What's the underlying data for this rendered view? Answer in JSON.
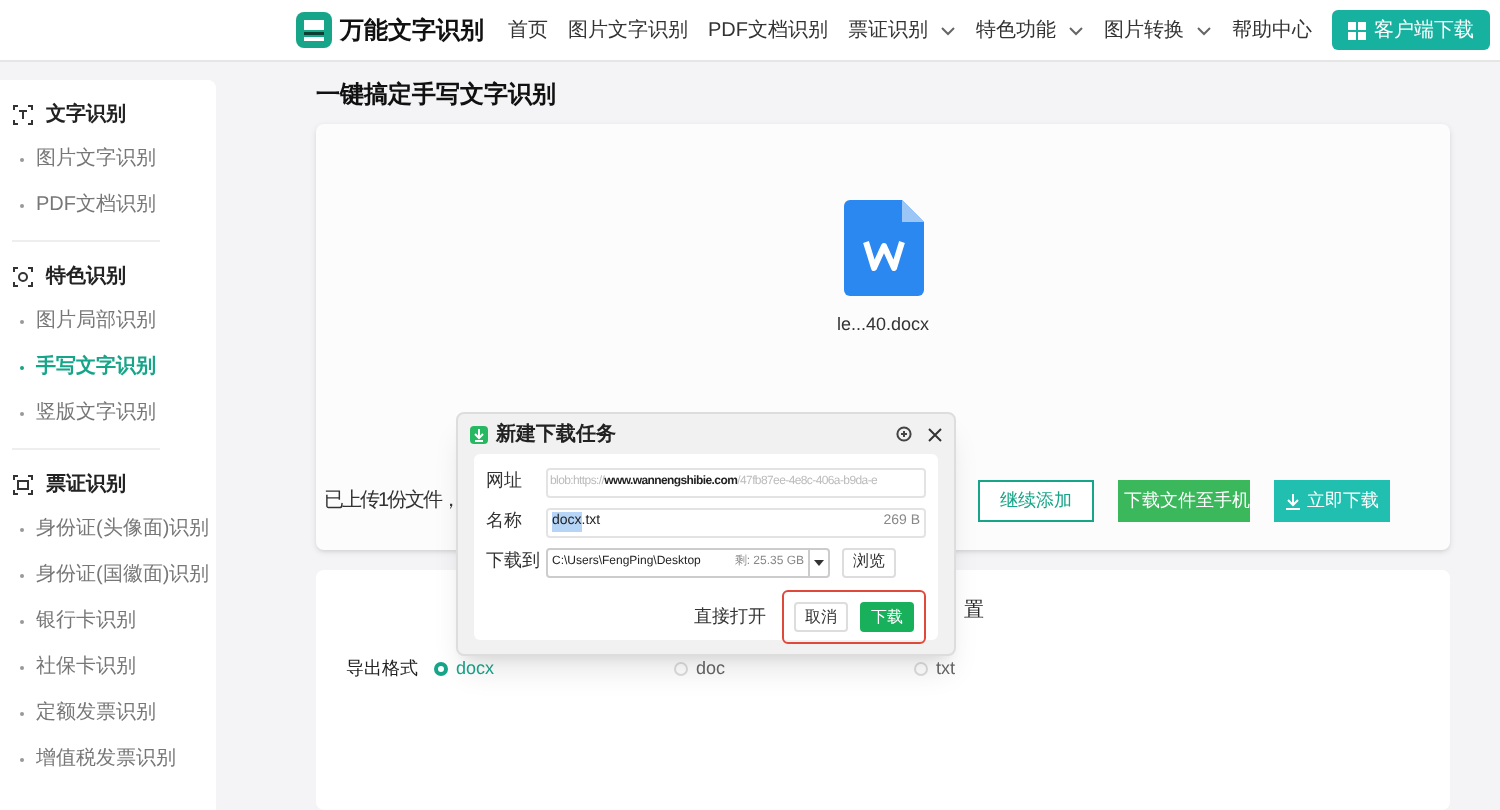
{
  "header": {
    "brand": "万能文字识别",
    "nav": [
      {
        "label": "首页",
        "dropdown": false
      },
      {
        "label": "图片文字识别",
        "dropdown": false
      },
      {
        "label": "PDF文档识别",
        "dropdown": false
      },
      {
        "label": "票证识别",
        "dropdown": true
      },
      {
        "label": "特色功能",
        "dropdown": true
      },
      {
        "label": "图片转换",
        "dropdown": true
      },
      {
        "label": "帮助中心",
        "dropdown": false
      }
    ],
    "download_button": "客户端下载"
  },
  "sidebar": {
    "groups": [
      {
        "title": "文字识别",
        "kind": "text",
        "items": [
          {
            "label": "图片文字识别",
            "selected": false
          },
          {
            "label": "PDF文档识别",
            "selected": false
          }
        ]
      },
      {
        "title": "特色识别",
        "kind": "feature",
        "items": [
          {
            "label": "图片局部识别",
            "selected": false
          },
          {
            "label": "手写文字识别",
            "selected": true
          },
          {
            "label": "竖版文字识别",
            "selected": false
          }
        ]
      },
      {
        "title": "票证识别",
        "kind": "card",
        "items": [
          {
            "label": "身份证(头像面)识别",
            "selected": false
          },
          {
            "label": "身份证(国徽面)识别",
            "selected": false
          },
          {
            "label": "银行卡识别",
            "selected": false
          },
          {
            "label": "社保卡识别",
            "selected": false
          },
          {
            "label": "定额发票识别",
            "selected": false
          },
          {
            "label": "增值税发票识别",
            "selected": false
          }
        ]
      }
    ]
  },
  "page_title": "一键搞定手写文字识别",
  "upload_card": {
    "file_name": "le...40.docx",
    "status": "已上传1份文件，",
    "buttons": [
      {
        "label": "继续添加",
        "kind": "outline"
      },
      {
        "label": "下载文件至手机",
        "kind": "phone"
      },
      {
        "label": "立即下载",
        "kind": "download"
      }
    ]
  },
  "settings_card": {
    "heading_fragment": "置",
    "export_label": "导出格式",
    "options": [
      {
        "label": "docx",
        "selected": true
      },
      {
        "label": "doc",
        "selected": false
      },
      {
        "label": "txt",
        "selected": false
      }
    ]
  },
  "dialog": {
    "title": "新建下载任务",
    "url_label": "网址",
    "url": "blob:https://**www.wannengshibie.com**/47fb87ee-4e8c-406a-b9da-e",
    "name_label": "名称",
    "name_selected": "docx",
    "name_rest": ".txt",
    "size": "269 B",
    "save_label": "下载到",
    "path": "C:\\Users\\FengPing\\Desktop",
    "free_space": "剩: 25.35 GB",
    "browse": "浏览",
    "open_direct": "直接打开",
    "cancel": "取消",
    "download": "下载",
    "highlight": true
  }
}
